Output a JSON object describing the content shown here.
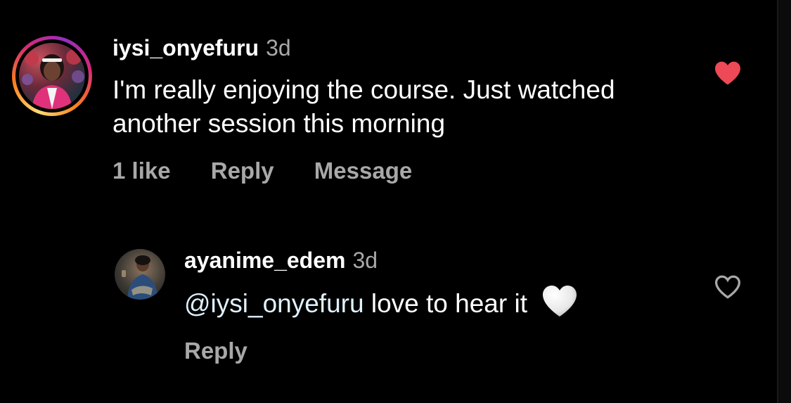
{
  "comment": {
    "username": "iysi_onyefuru",
    "time": "3d",
    "text": "I'm really enjoying the course. Just watched another session this morning",
    "likes_label": "1 like",
    "reply_label": "Reply",
    "message_label": "Message",
    "liked": true,
    "like_color": "#ed4956"
  },
  "reply": {
    "username": "ayanime_edem",
    "time": "3d",
    "mention": "@iysi_onyefuru",
    "text": " love to hear it ",
    "emoji": "white-heart-emoji",
    "reply_label": "Reply",
    "liked": false
  },
  "colors": {
    "background": "#000000",
    "secondary_text": "#a8a8a8",
    "mention": "#e0f1ff"
  }
}
